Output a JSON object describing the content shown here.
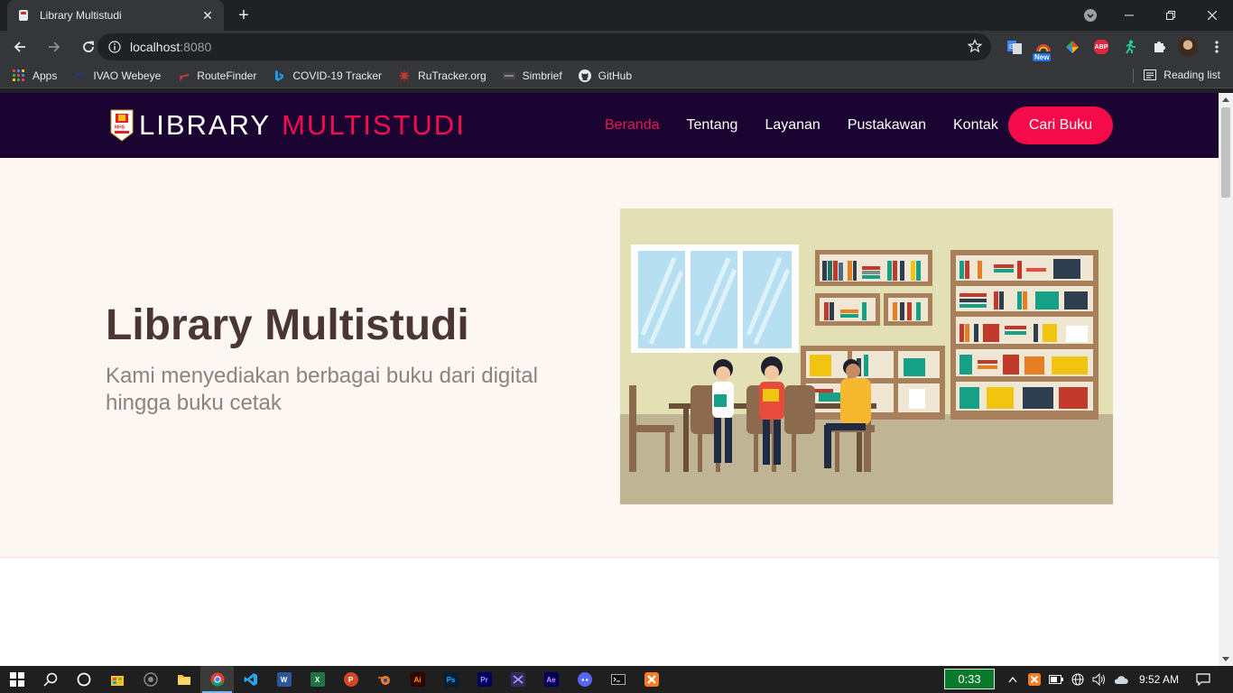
{
  "browser": {
    "tab_title": "Library Multistudi",
    "new_tab": "+",
    "url_host": "localhost",
    "url_port": ":8080",
    "extension_badge": "New",
    "abp_label": "ABP",
    "bookmarks": [
      "Apps",
      "IVAO Webeye",
      "RouteFinder",
      "COVID-19 Tracker",
      "RuTracker.org",
      "Simbrief",
      "GitHub"
    ],
    "reading_list": "Reading list"
  },
  "site": {
    "brand_part1": "LIBRARY",
    "brand_part2": "MULTISTUDI",
    "logo_text": "MHS",
    "nav": [
      "Beranda",
      "Tentang",
      "Layanan",
      "Pustakawan",
      "Kontak"
    ],
    "active_nav": "Beranda",
    "cta_label": "Cari Buku",
    "hero_title": "Library Multistudi",
    "hero_subtitle": "Kami menyediakan berbagai buku dari digital hingga buku cetak",
    "colors": {
      "nav_bg": "#1b0432",
      "accent": "#f50a4a",
      "hero_bg": "#fcf7f3",
      "title": "#4a3732",
      "subtitle": "#8f827c"
    }
  },
  "taskbar": {
    "apps": [
      "start-icon",
      "search-icon",
      "cortana-icon",
      "store-icon",
      "github-desktop-icon",
      "file-explorer-icon",
      "chrome-icon",
      "vscode-icon",
      "word-icon",
      "excel-icon",
      "powerpoint-icon",
      "blender-icon",
      "illustrator-icon",
      "photoshop-icon",
      "premiere-icon",
      "visual-studio-icon",
      "after-effects-icon",
      "discord-icon",
      "terminal-icon",
      "xampp-icon"
    ],
    "labels": {
      "word": "W",
      "excel": "X",
      "powerpoint": "P",
      "illustrator": "Ai",
      "photoshop": "Ps",
      "premiere": "Pr",
      "after_effects": "Ae"
    },
    "timer": "0:33",
    "clock": "9:52 AM"
  }
}
